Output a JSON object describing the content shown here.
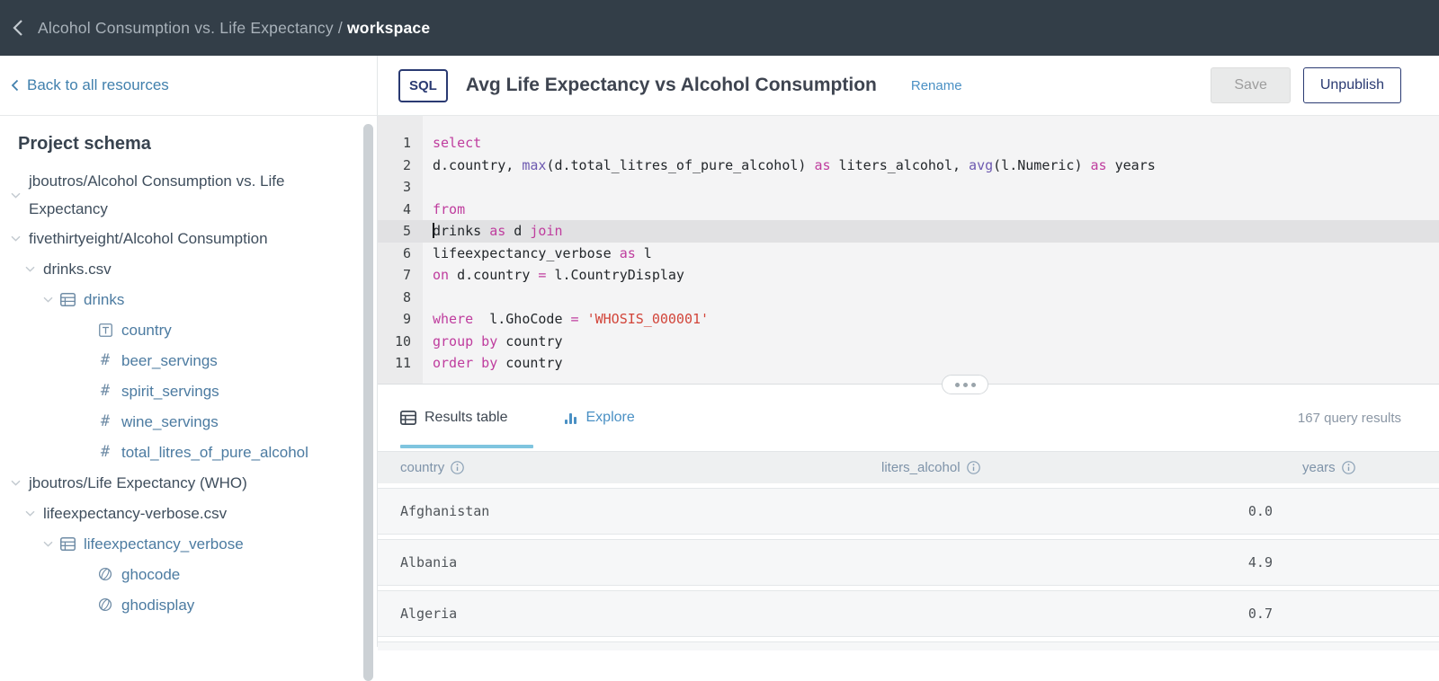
{
  "topbar": {
    "back_icon": "chevron-left-icon",
    "title_prefix": "Alcohol Consumption vs. Life Expectancy /",
    "title_bold": "workspace"
  },
  "sidebar": {
    "back_label": "Back to all resources",
    "schema_heading": "Project schema",
    "tree": [
      {
        "label": "jboutros/Alcohol Consumption vs. Life Expectancy",
        "level": 0,
        "kind": "dataset",
        "icon": "",
        "expandable": true
      },
      {
        "label": "fivethirtyeight/Alcohol Consumption",
        "level": 0,
        "kind": "dataset",
        "icon": "",
        "expandable": true
      },
      {
        "label": "drinks.csv",
        "level": 1,
        "kind": "file",
        "icon": "",
        "expandable": true
      },
      {
        "label": "drinks",
        "level": 2,
        "kind": "table",
        "icon": "table-icon",
        "expandable": true
      },
      {
        "label": "country",
        "level": 3,
        "kind": "column",
        "icon": "text-column-icon",
        "expandable": false
      },
      {
        "label": "beer_servings",
        "level": 3,
        "kind": "column",
        "icon": "number-column-icon",
        "expandable": false
      },
      {
        "label": "spirit_servings",
        "level": 3,
        "kind": "column",
        "icon": "number-column-icon",
        "expandable": false
      },
      {
        "label": "wine_servings",
        "level": 3,
        "kind": "column",
        "icon": "number-column-icon",
        "expandable": false
      },
      {
        "label": "total_litres_of_pure_alcohol",
        "level": 3,
        "kind": "column",
        "icon": "number-column-icon",
        "expandable": false
      },
      {
        "label": "jboutros/Life Expectancy (WHO)",
        "level": 0,
        "kind": "dataset",
        "icon": "",
        "expandable": true
      },
      {
        "label": "lifeexpectancy-verbose.csv",
        "level": 1,
        "kind": "file",
        "icon": "",
        "expandable": true
      },
      {
        "label": "lifeexpectancy_verbose",
        "level": 2,
        "kind": "table",
        "icon": "table-icon",
        "expandable": true
      },
      {
        "label": "ghocode",
        "level": 3,
        "kind": "column",
        "icon": "globe-icon",
        "expandable": false
      },
      {
        "label": "ghodisplay",
        "level": 3,
        "kind": "column",
        "icon": "globe-icon",
        "expandable": false
      }
    ]
  },
  "header": {
    "type_badge": "SQL",
    "query_title": "Avg Life Expectancy vs Alcohol Consumption",
    "rename_label": "Rename",
    "save_label": "Save",
    "unpublish_label": "Unpublish"
  },
  "editor": {
    "active_line": 5,
    "lines": [
      {
        "n": "1",
        "tokens": [
          [
            "kw",
            "select"
          ]
        ]
      },
      {
        "n": "2",
        "tokens": [
          [
            "pl",
            "d.country, "
          ],
          [
            "fn",
            "max"
          ],
          [
            "pl",
            "(d.total_litres_of_pure_alcohol) "
          ],
          [
            "kw",
            "as"
          ],
          [
            "pl",
            " liters_alcohol, "
          ],
          [
            "fn",
            "avg"
          ],
          [
            "pl",
            "(l.Numeric) "
          ],
          [
            "kw",
            "as"
          ],
          [
            "pl",
            " years"
          ]
        ]
      },
      {
        "n": "3",
        "tokens": []
      },
      {
        "n": "4",
        "tokens": [
          [
            "kw",
            "from"
          ]
        ]
      },
      {
        "n": "5",
        "tokens": [
          [
            "pl",
            "drinks "
          ],
          [
            "kw",
            "as"
          ],
          [
            "pl",
            " d "
          ],
          [
            "kw",
            "join"
          ]
        ],
        "active": true,
        "cursor": true
      },
      {
        "n": "6",
        "tokens": [
          [
            "pl",
            "lifeexpectancy_verbose "
          ],
          [
            "kw",
            "as"
          ],
          [
            "pl",
            " l"
          ]
        ]
      },
      {
        "n": "7",
        "tokens": [
          [
            "kw",
            "on"
          ],
          [
            "pl",
            " d.country "
          ],
          [
            "kw",
            "="
          ],
          [
            "pl",
            " l.CountryDisplay"
          ]
        ]
      },
      {
        "n": "8",
        "tokens": []
      },
      {
        "n": "9",
        "tokens": [
          [
            "kw",
            "where"
          ],
          [
            "pl",
            "  l.GhoCode "
          ],
          [
            "kw",
            "="
          ],
          [
            "pl",
            " "
          ],
          [
            "str",
            "'WHOSIS_000001'"
          ]
        ]
      },
      {
        "n": "10",
        "tokens": [
          [
            "kw",
            "group by"
          ],
          [
            "pl",
            " country"
          ]
        ]
      },
      {
        "n": "11",
        "tokens": [
          [
            "kw",
            "order by"
          ],
          [
            "pl",
            " country"
          ]
        ]
      }
    ]
  },
  "results": {
    "tabs": [
      {
        "label": "Results table",
        "icon": "results-table-icon",
        "active": true
      },
      {
        "label": "Explore",
        "icon": "explore-icon",
        "active": false
      }
    ],
    "count_label": "167 query results",
    "columns": [
      "country",
      "liters_alcohol",
      "years"
    ],
    "rows": [
      {
        "country": "Afghanistan",
        "liters_alcohol": "0.0",
        "years": ""
      },
      {
        "country": "Albania",
        "liters_alcohol": "4.9",
        "years": ""
      },
      {
        "country": "Algeria",
        "liters_alcohol": "0.7",
        "years": ""
      }
    ]
  },
  "colors": {
    "topbar_bg": "#333e48",
    "link_blue": "#4a90c4",
    "sidebar_link_blue": "#4180ad",
    "navy": "#2a3a72",
    "schema_column_blue": "#4c7ba1",
    "sql_keyword": "#bf3d9e",
    "sql_function": "#6d59b0",
    "sql_string": "#d2453a",
    "tab_underline": "#7fc5df",
    "table_header_text": "#7e93a9"
  }
}
